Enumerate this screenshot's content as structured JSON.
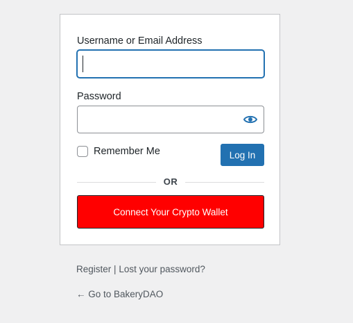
{
  "login_form": {
    "username_label": "Username or Email Address",
    "username_value": "",
    "password_label": "Password",
    "password_value": "",
    "show_password_icon": "eye-icon",
    "remember_label": "Remember Me",
    "remember_checked": false,
    "login_button": "Log In",
    "divider_text": "OR",
    "wallet_button": "Connect Your Crypto Wallet"
  },
  "nav": {
    "register": "Register",
    "separator": "|",
    "lost_password": "Lost your password?",
    "back_arrow": "←",
    "back_label": "Go to BakeryDAO"
  },
  "colors": {
    "background": "#f0f0f1",
    "primary": "#2271b1",
    "wallet": "#ff0000"
  }
}
